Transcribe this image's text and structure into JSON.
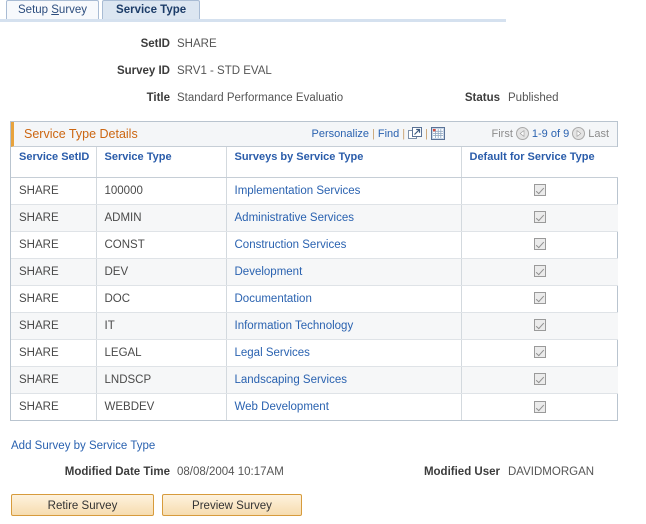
{
  "tabs": [
    {
      "label": "Setup Survey",
      "active": false,
      "accesskey_index": 6
    },
    {
      "label": "Service Type",
      "active": true
    }
  ],
  "header_fields": [
    {
      "label": "SetID",
      "value": "SHARE"
    },
    {
      "label": "Survey ID",
      "value": "SRV1 - STD EVAL"
    },
    {
      "label": "Title",
      "value": "Standard Performance Evaluatio"
    }
  ],
  "status": {
    "label": "Status",
    "value": "Published"
  },
  "grid": {
    "title": "Service Type Details",
    "actions": {
      "personalize": "Personalize",
      "find": "Find",
      "separator": "|",
      "new_window_icon": "new-window-icon",
      "download_icon": "spreadsheet-download-icon"
    },
    "nav": {
      "first": "First",
      "prev_icon": "previous-page-icon",
      "range": "1-9 of 9",
      "next_icon": "next-page-icon",
      "last": "Last"
    },
    "columns": [
      "Service SetID",
      "Service Type",
      "Surveys by Service Type",
      "Default for Service Type"
    ],
    "rows": [
      {
        "setid": "SHARE",
        "type": "100000",
        "survey": "Implementation Services",
        "default": true
      },
      {
        "setid": "SHARE",
        "type": "ADMIN",
        "survey": "Administrative Services",
        "default": true
      },
      {
        "setid": "SHARE",
        "type": "CONST",
        "survey": "Construction Services",
        "default": true
      },
      {
        "setid": "SHARE",
        "type": "DEV",
        "survey": "Development",
        "default": true
      },
      {
        "setid": "SHARE",
        "type": "DOC",
        "survey": "Documentation",
        "default": true
      },
      {
        "setid": "SHARE",
        "type": "IT",
        "survey": "Information Technology",
        "default": true
      },
      {
        "setid": "SHARE",
        "type": "LEGAL",
        "survey": "Legal Services",
        "default": true
      },
      {
        "setid": "SHARE",
        "type": "LNDSCP",
        "survey": "Landscaping Services",
        "default": true
      },
      {
        "setid": "SHARE",
        "type": "WEBDEV",
        "survey": "Web Development",
        "default": true
      }
    ]
  },
  "add_link": "Add Survey by Service Type",
  "footer_fields": [
    {
      "label": "Modified Date Time",
      "value": "08/08/2004 10:17AM"
    },
    {
      "label": "Modified User",
      "value": "DAVIDMORGAN"
    }
  ],
  "buttons": [
    {
      "label": "Retire Survey",
      "name": "retire-survey-button"
    },
    {
      "label": "Preview Survey",
      "name": "preview-survey-button"
    }
  ],
  "colors": {
    "grid_title": "#cc6611",
    "link": "#2a62b0",
    "accent_bar": "#e8a33d",
    "button_border": "#d79b3c",
    "active_tab_bg": "#dce6f1"
  }
}
